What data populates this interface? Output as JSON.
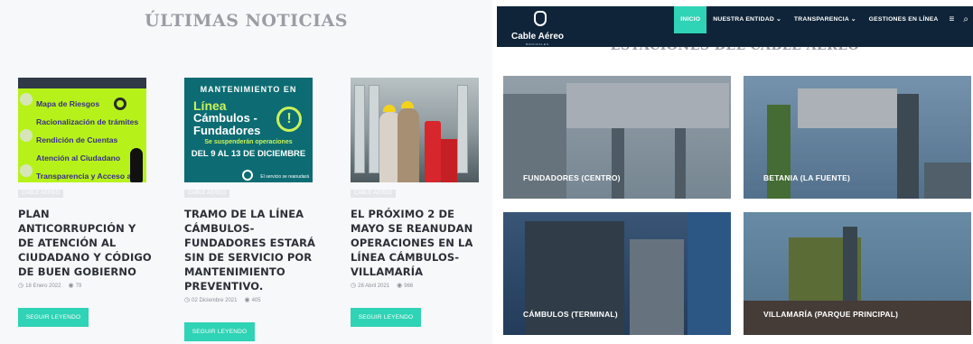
{
  "news": {
    "title": "ÚLTIMAS NOTICIAS",
    "cards": [
      {
        "image_lines": [
          "Mapa de Riesgos",
          "Racionalización de trámites",
          "Rendición de Cuentas",
          "Atención al Ciudadano",
          "Transparencia y Acceso a"
        ],
        "tag": "CABLE AÉREO",
        "title": "PLAN ANTICORRUPCIÓN Y DE ATENCIÓN AL CIUDADANO Y CÓDIGO DE BUEN GOBIERNO",
        "date": "18 Enero 2022",
        "views": "79",
        "button": "SEGUIR LEYENDO"
      },
      {
        "image_lines": [
          "MANTENIMIENTO EN",
          "Línea",
          "Cámbulos - Fundadores",
          "Se suspenderán operaciones",
          "DEL 9 AL 13 DE DICIEMBRE",
          "El servicio se reanudará"
        ],
        "tag": "CABLE AÉREO",
        "title": "TRAMO DE LA LÍNEA CÁMBULOS-FUNDADORES ESTARÁ SIN DE SERVICIO POR MANTENIMIENTO PREVENTIVO.",
        "date": "02 Diciembre 2021",
        "views": "405",
        "button": "SEGUIR LEYENDO"
      },
      {
        "tag": "CABLE AÉREO",
        "title": "EL PRÓXIMO 2 DE MAYO SE REANUDAN OPERACIONES EN LA LÍNEA CÁMBULOS-VILLAMARÍA",
        "date": "28 Abril 2021",
        "views": "966",
        "button": "SEGUIR LEYENDO"
      }
    ]
  },
  "stations": {
    "brand": "Cable Aéreo",
    "brand_sub": "MANIZALES",
    "nav": [
      "INICIO",
      "NUESTRA ENTIDAD ⌄",
      "TRANSPARENCIA ⌄",
      "GESTIONES EN LÍNEA"
    ],
    "section_title": "ESTACIONES DEL CABLE AÉREO",
    "tiles": [
      "FUNDADORES (CENTRO)",
      "BETANIA (LA FUENTE)",
      "CÁMBULOS (TERMINAL)",
      "VILLAMARÍA (PARQUE PRINCIPAL)"
    ]
  },
  "colors": {
    "accent": "#2fd3b5",
    "navbar": "#0f2438",
    "title_gray": "#9a9ea4"
  },
  "icons": {
    "date": "clock-icon",
    "views": "eye-icon",
    "menu": "hamburger-icon",
    "search": "search-icon"
  }
}
